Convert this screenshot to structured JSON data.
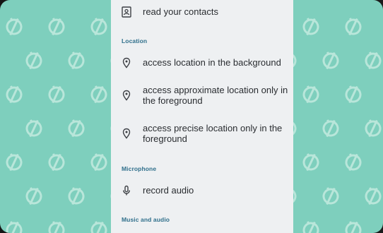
{
  "permissions": {
    "contacts_item": "read your contacts",
    "location_header": "Location",
    "location_items": [
      "access location in the background",
      "access approximate location only in the foreground",
      "access precise location only in the foreground"
    ],
    "microphone_header": "Microphone",
    "microphone_items": [
      "record audio"
    ],
    "music_header": "Music and audio"
  },
  "colors": {
    "wallpaper": "#7ecfbd",
    "panel": "#eef0f2",
    "section_header": "#2f6f8b"
  },
  "icons": {
    "contacts": "contact-card-icon",
    "location": "location-pin-icon",
    "microphone": "microphone-icon",
    "wallpaper_pattern": "no-speed-gauge-icon"
  }
}
